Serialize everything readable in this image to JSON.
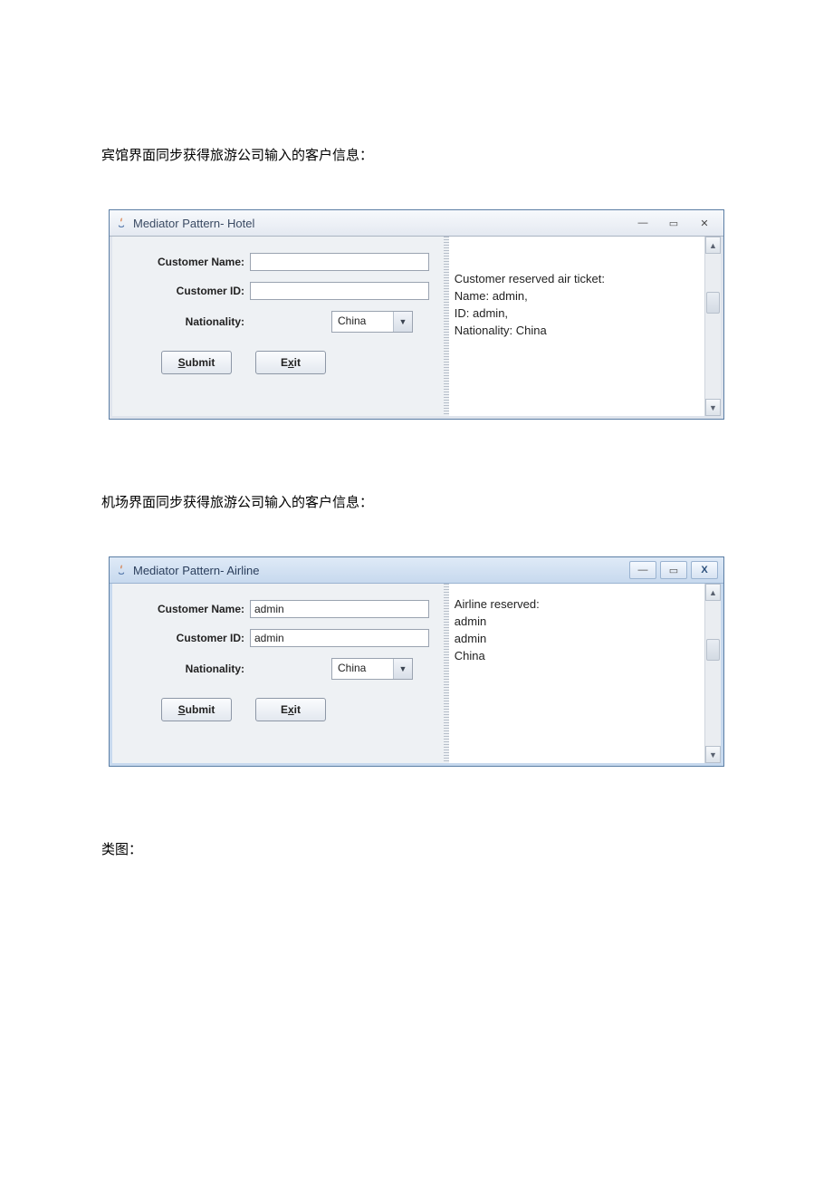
{
  "captions": {
    "hotel": "宾馆界面同步获得旅游公司输入的客户信息：",
    "airline": "机场界面同步获得旅游公司输入的客户信息：",
    "class_diagram": "类图："
  },
  "window_hotel": {
    "title": "Mediator Pattern- Hotel",
    "labels": {
      "customer_name": "Customer Name:",
      "customer_id": "Customer ID:",
      "nationality": "Nationality:"
    },
    "fields": {
      "customer_name": "",
      "customer_id": "",
      "nationality_selected": "China"
    },
    "buttons": {
      "submit": "Submit",
      "exit": "Exit"
    },
    "right_text": "Customer reserved air ticket:\nName: admin,\nID: admin,\nNationality: China"
  },
  "window_airline": {
    "title": "Mediator Pattern- Airline",
    "labels": {
      "customer_name": "Customer Name:",
      "customer_id": "Customer ID:",
      "nationality": "Nationality:"
    },
    "fields": {
      "customer_name": "admin",
      "customer_id": "admin",
      "nationality_selected": "China"
    },
    "buttons": {
      "submit": "Submit",
      "exit": "Exit"
    },
    "right_text": "Airline reserved:\nadmin\nadmin\nChina"
  },
  "win_controls": {
    "minimize": "—",
    "maximize": "▭",
    "close_basic": "✕",
    "close_x": "X"
  },
  "scroll": {
    "up": "▲",
    "down": "▼"
  }
}
